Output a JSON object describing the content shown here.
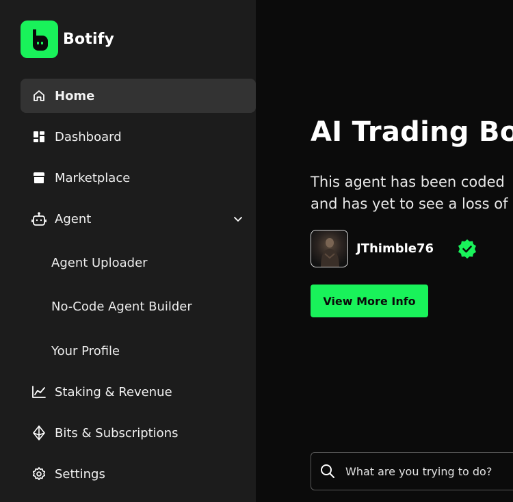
{
  "brand": {
    "name": "Botify",
    "accent": "#19f25a"
  },
  "sidebar": {
    "items": [
      {
        "label": "Home",
        "icon": "home-icon",
        "active": true
      },
      {
        "label": "Dashboard",
        "icon": "dashboard-icon"
      },
      {
        "label": "Marketplace",
        "icon": "store-icon"
      },
      {
        "label": "Agent",
        "icon": "robot-icon",
        "expanded": true
      },
      {
        "label": "Staking & Revenue",
        "icon": "chart-line-icon"
      },
      {
        "label": "Bits & Subscriptions",
        "icon": "diamond-icon"
      },
      {
        "label": "Settings",
        "icon": "gear-icon"
      }
    ],
    "agent_subitems": [
      {
        "label": "Agent Uploader"
      },
      {
        "label": "No-Code Agent Builder"
      },
      {
        "label": "Your Profile"
      }
    ]
  },
  "hero": {
    "title": "AI Trading Bot",
    "description_line1": "This agent has been coded",
    "description_line2": "and has yet to see a loss of",
    "author": "JThimble76",
    "verified": true,
    "cta_label": "View More Info"
  },
  "search": {
    "placeholder": "What are you trying to do?"
  }
}
